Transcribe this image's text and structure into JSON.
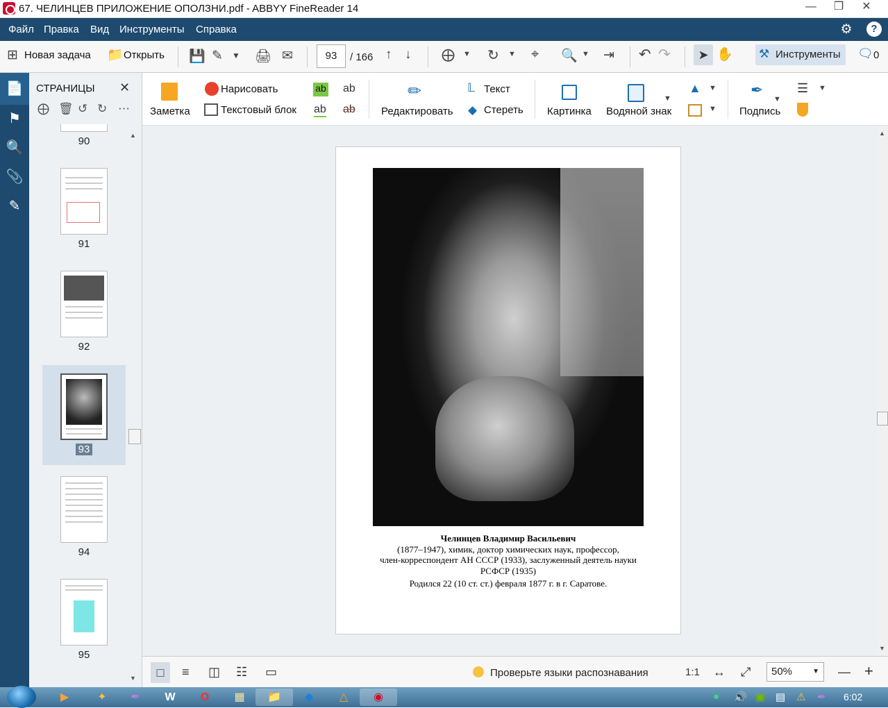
{
  "window": {
    "title": "67.  ЧЕЛИНЦЕВ ПРИЛОЖЕНИЕ  ОПОЛЗНИ.pdf - ABBYY FineReader 14"
  },
  "menu": [
    "Файл",
    "Правка",
    "Вид",
    "Инструменты",
    "Справка"
  ],
  "toolbar": {
    "new_task": "Новая задача",
    "open": "Открыть",
    "page_current": "93",
    "page_total": "/ 166",
    "tools": "Инструменты",
    "comments_count": "0"
  },
  "sidebar": {
    "title": "СТРАНИЦЫ",
    "pages": [
      "90",
      "91",
      "92",
      "93",
      "94",
      "95"
    ],
    "selected_page": "93"
  },
  "ribbon": {
    "note": "Заметка",
    "draw": "Нарисовать",
    "textblock": "Текстовый блок",
    "edit": "Редактировать",
    "text": "Текст",
    "erase": "Стереть",
    "picture": "Картинка",
    "watermark": "Водяной знак",
    "signature": "Подпись"
  },
  "document": {
    "caption_name": "Челинцев Владимир Васильевич",
    "caption_line1": "(1877–1947), химик, доктор  химических наук, профессор,",
    "caption_line2": "член-корреспондент АН СССР (1933),    заслуженный деятель науки",
    "caption_line3": "РСФСР (1935)",
    "caption_line4": "Родился 22 (10 ст. ст.) февраля 1877 г. в г. Саратове."
  },
  "statusbar": {
    "check_langs": "Проверьте языки распознавания",
    "ratio": "1:1",
    "zoom": "50%"
  },
  "taskbar": {
    "clock": "6:02"
  }
}
